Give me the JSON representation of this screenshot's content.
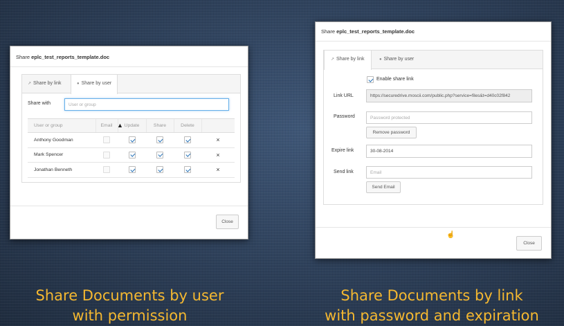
{
  "dialog_user": {
    "title_prefix": "Share ",
    "title_file": "eplc_test_reports_template.doc",
    "tabs": [
      {
        "label": "Share by link",
        "icon": "share-link-icon"
      },
      {
        "label": "Share by user",
        "icon": "user-icon"
      }
    ],
    "active_tab": "Share by user",
    "share_with_label": "Share with",
    "share_with_placeholder": "User or group",
    "columns": [
      "User or group",
      "Email",
      "Update",
      "Share",
      "Delete"
    ],
    "rows": [
      {
        "name": "Anthony Goodman",
        "email": false,
        "update": true,
        "share": true,
        "delete": true
      },
      {
        "name": "Mark Spencer",
        "email": false,
        "update": true,
        "share": true,
        "delete": true
      },
      {
        "name": "Jonathan Benneth",
        "email": false,
        "update": true,
        "share": true,
        "delete": true
      }
    ],
    "remove_symbol": "×",
    "close_label": "Close"
  },
  "dialog_link": {
    "title_prefix": "Share ",
    "title_file": "eplc_test_reports_template.doc",
    "tabs": [
      {
        "label": "Share by link",
        "icon": "share-link-icon"
      },
      {
        "label": "Share by user",
        "icon": "user-icon"
      }
    ],
    "active_tab": "Share by link",
    "enable_label": "Enable share link",
    "enable_checked": true,
    "link_url_label": "Link URL",
    "link_url_value": "https://securedrive.moscii.com/public.php?service=files&t=d40c02f842",
    "password_label": "Password",
    "password_placeholder": "Password protected",
    "remove_password_label": "Remove password",
    "expire_label": "Expire link",
    "expire_value": "30-08-2014",
    "send_label": "Send link",
    "email_placeholder": "Email",
    "send_email_label": "Send Email",
    "close_label": "Close"
  },
  "captions": {
    "left_line1": "Share Documents by user",
    "left_line2": "with permission",
    "right_line1": "Share Documents by link",
    "right_line2": "with password and expiration"
  },
  "colors": {
    "caption": "#f5b830",
    "background": "#2c3e55",
    "check": "#2a74b8"
  }
}
